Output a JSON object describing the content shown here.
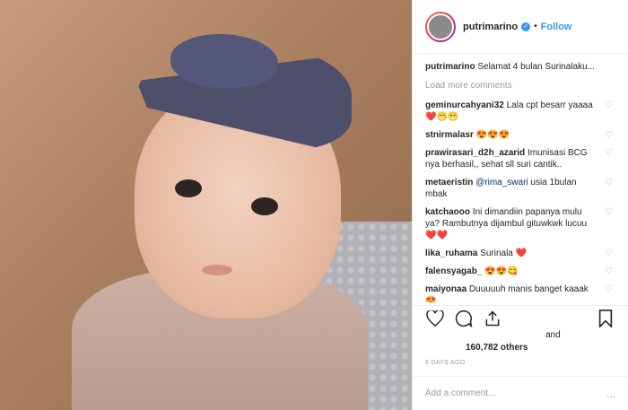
{
  "post": {
    "username": "putrimarino",
    "follow_label": "Follow",
    "separator": "•",
    "caption_text": "Selamat 4 bulan Surinalaku...",
    "load_more": "Load more comments",
    "comments": [
      {
        "user": "geminurcahyani32",
        "text": "Lala cpt besarr yaaaa",
        "emoji": "❤️😁😁"
      },
      {
        "user": "stnirmalasr",
        "text": "",
        "emoji": "😍😍😍"
      },
      {
        "user": "prawirasari_d2h_azarid",
        "text": "Imunisasi BCG nya berhasil,, sehat sll suri cantik..",
        "emoji": ""
      },
      {
        "user": "metaeristin",
        "mention": "@rima_swari",
        "text": "usia 1bulan mbak",
        "emoji": ""
      },
      {
        "user": "katchaooo",
        "text": "Ini dimandiin papanya mulu ya? Rambutnya dijambul gituwkwk lucuu",
        "emoji": "❤️❤️"
      },
      {
        "user": "lika_ruhama",
        "text": "Surinala",
        "emoji": "❤️"
      },
      {
        "user": "falensyagab_",
        "text": "",
        "emoji": "😍😍😋"
      },
      {
        "user": "maiyonaa",
        "text": "Duuuuuh manis banget kaaak",
        "emoji": "😍"
      }
    ],
    "likes_and": "and",
    "likes_count": "160,782 others",
    "timestamp": "6 DAYS AGO",
    "add_comment_placeholder": "Add a comment...",
    "more_dots": "..."
  },
  "colors": {
    "accent": "#3897f0",
    "muted": "#999999",
    "text": "#262626"
  }
}
